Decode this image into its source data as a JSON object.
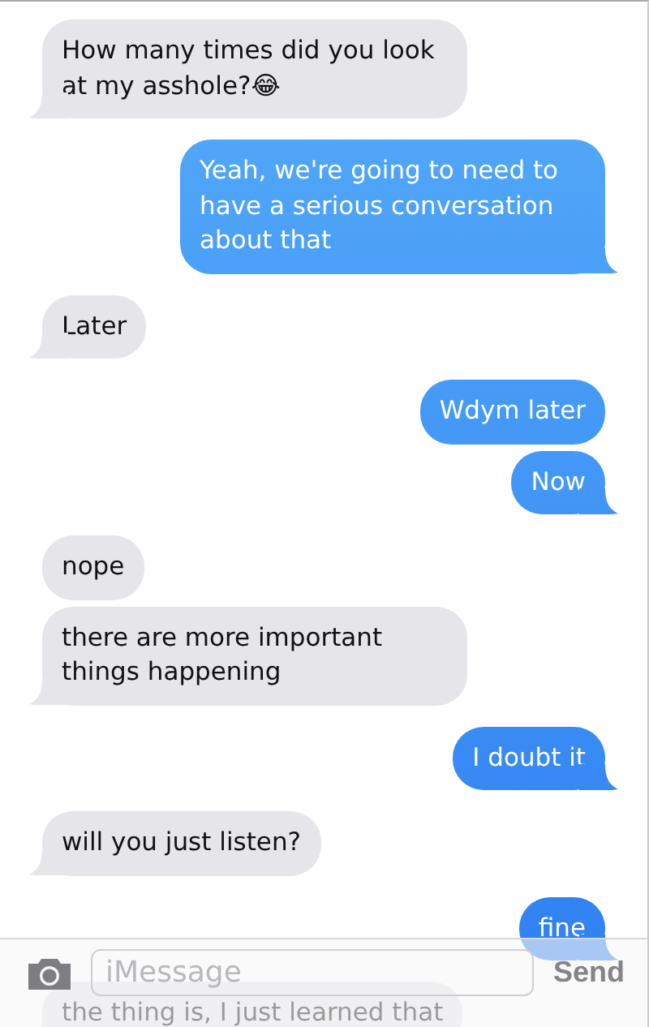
{
  "messages": [
    {
      "kind": "received",
      "text": "How many times did you look at my asshole?😂"
    },
    {
      "kind": "sent",
      "text": "Yeah, we're going to need to have a serious conversation about that"
    },
    {
      "kind": "received",
      "text": "Later"
    },
    {
      "kind": "sent",
      "text": "Wdym later"
    },
    {
      "kind": "sent",
      "text": "Now"
    },
    {
      "kind": "received",
      "text": "nope"
    },
    {
      "kind": "received",
      "text": "there are more important things happening"
    },
    {
      "kind": "sent",
      "text": "I doubt it"
    },
    {
      "kind": "received",
      "text": "will you just listen?"
    },
    {
      "kind": "sent",
      "text": "fine"
    },
    {
      "kind": "received",
      "text": "the thing is, I just learned that"
    }
  ],
  "composer": {
    "placeholder": "iMessage",
    "send": "Send"
  }
}
